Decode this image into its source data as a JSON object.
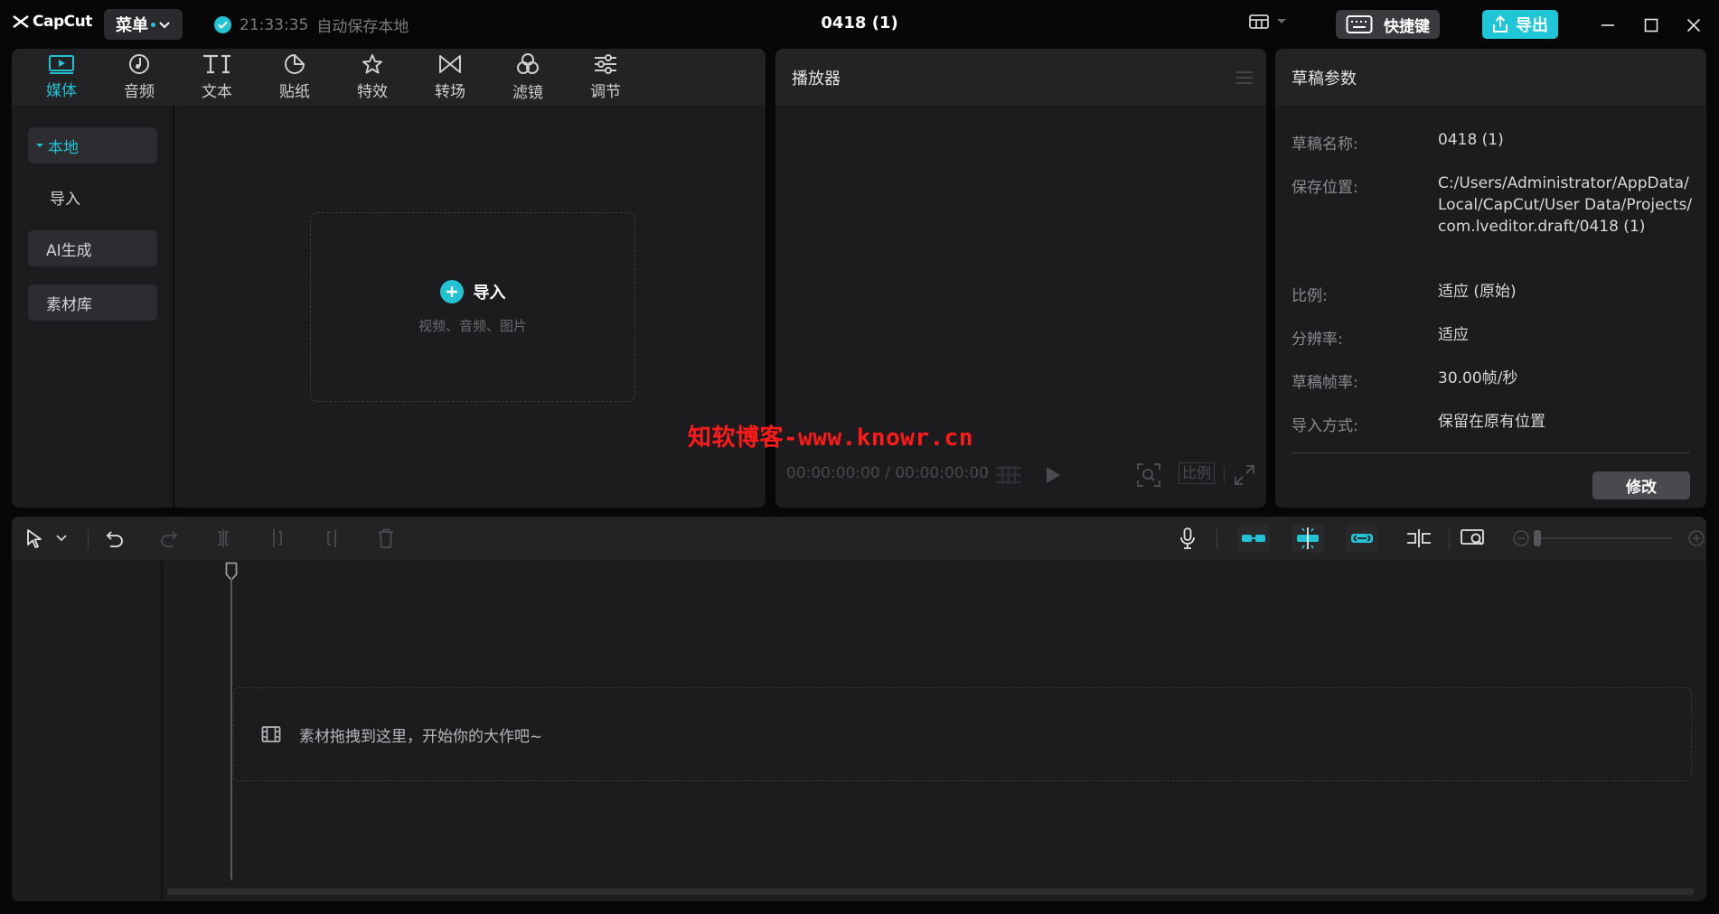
{
  "titlebar": {
    "app_name": "CapCut",
    "menu_label": "菜单",
    "save_time": "21:33:35",
    "save_status": "自动保存本地",
    "project_title": "0418 (1)",
    "shortcut_label": "快捷键",
    "export_label": "导出"
  },
  "colors": {
    "accent": "#21c2d4",
    "watermark": "#ff1a1a",
    "panel": "#1c1c1f"
  },
  "media": {
    "tabs": [
      {
        "label": "媒体",
        "icon": "media-icon"
      },
      {
        "label": "音频",
        "icon": "audio-icon"
      },
      {
        "label": "文本",
        "icon": "text-icon"
      },
      {
        "label": "贴纸",
        "icon": "sticker-icon"
      },
      {
        "label": "特效",
        "icon": "effects-icon"
      },
      {
        "label": "转场",
        "icon": "transition-icon"
      },
      {
        "label": "滤镜",
        "icon": "filter-icon"
      },
      {
        "label": "调节",
        "icon": "adjust-icon"
      }
    ],
    "side_nav": [
      {
        "label": "本地"
      },
      {
        "label": "导入"
      },
      {
        "label": "AI生成"
      },
      {
        "label": "素材库"
      }
    ],
    "import_label": "导入",
    "import_hint": "视频、音频、图片"
  },
  "player": {
    "title": "播放器",
    "timecode": "00:00:00:00 / 00:00:00:00",
    "ratio_label": "比例"
  },
  "params": {
    "title": "草稿参数",
    "rows": [
      {
        "label": "草稿名称:",
        "value": "0418 (1)"
      },
      {
        "label": "保存位置:",
        "value": "C:/Users/Administrator/AppData/Local/CapCut/User Data/Projects/com.lveditor.draft/0418 (1)"
      },
      {
        "label": "比例:",
        "value": "适应 (原始)"
      },
      {
        "label": "分辨率:",
        "value": "适应"
      },
      {
        "label": "草稿帧率:",
        "value": "30.00帧/秒"
      },
      {
        "label": "导入方式:",
        "value": "保留在原有位置"
      }
    ],
    "modify_label": "修改"
  },
  "watermark": "知软博客-www.knowr.cn",
  "timeline": {
    "drop_hint": "素材拖拽到这里，开始你的大作吧~"
  }
}
